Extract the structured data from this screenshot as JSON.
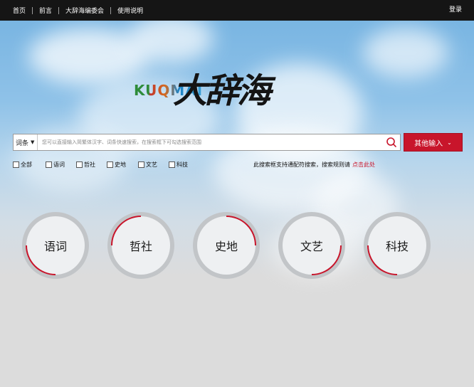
{
  "nav": {
    "items": [
      "首页",
      "前言",
      "大辞海编委会",
      "使用说明"
    ],
    "login": "登录"
  },
  "logo": {
    "latin": "KUQMAI",
    "han": "大辞海"
  },
  "search": {
    "scope": "词条",
    "placeholder": "您可以直接输入简繁体汉字、词条快速搜索，在搜索框下可勾选搜索范围",
    "other_input": "其他输入"
  },
  "filters": [
    "全部",
    "语词",
    "哲社",
    "史地",
    "文艺",
    "科技"
  ],
  "notice": {
    "text": "此搜索框支持通配符搜索，搜索规则请",
    "link": "点击此处"
  },
  "categories": [
    {
      "label": "语词"
    },
    {
      "label": "哲社"
    },
    {
      "label": "史地"
    },
    {
      "label": "文艺"
    },
    {
      "label": "科技"
    }
  ],
  "colors": {
    "accent": "#c8152b",
    "topbar": "#151515"
  }
}
